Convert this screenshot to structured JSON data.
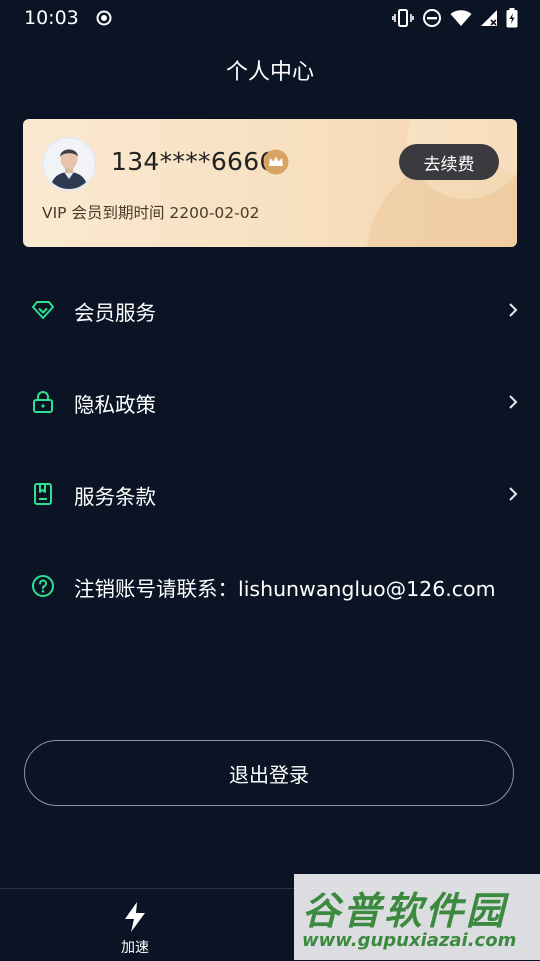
{
  "status_bar": {
    "time": "10:03"
  },
  "header": {
    "title": "个人中心"
  },
  "member_card": {
    "phone": "134****6666",
    "vip_expire": "VIP 会员到期时间 2200-02-02",
    "renew_label": "去续费"
  },
  "menu": {
    "items": [
      {
        "label": "会员服务",
        "icon": "diamond-icon"
      },
      {
        "label": "隐私政策",
        "icon": "lock-icon"
      },
      {
        "label": "服务条款",
        "icon": "document-icon"
      },
      {
        "label": "注销账号请联系：lishunwangluo@126.com",
        "icon": "help-circle-icon"
      }
    ]
  },
  "logout_label": "退出登录",
  "bottom_nav": {
    "accelerate_label": "加速"
  },
  "watermark": {
    "title": "谷普软件园",
    "url": "www.gupuxiazai.com"
  },
  "colors": {
    "accent": "#2ee08f",
    "background": "#0b1424",
    "card": "#f8e3c6"
  }
}
